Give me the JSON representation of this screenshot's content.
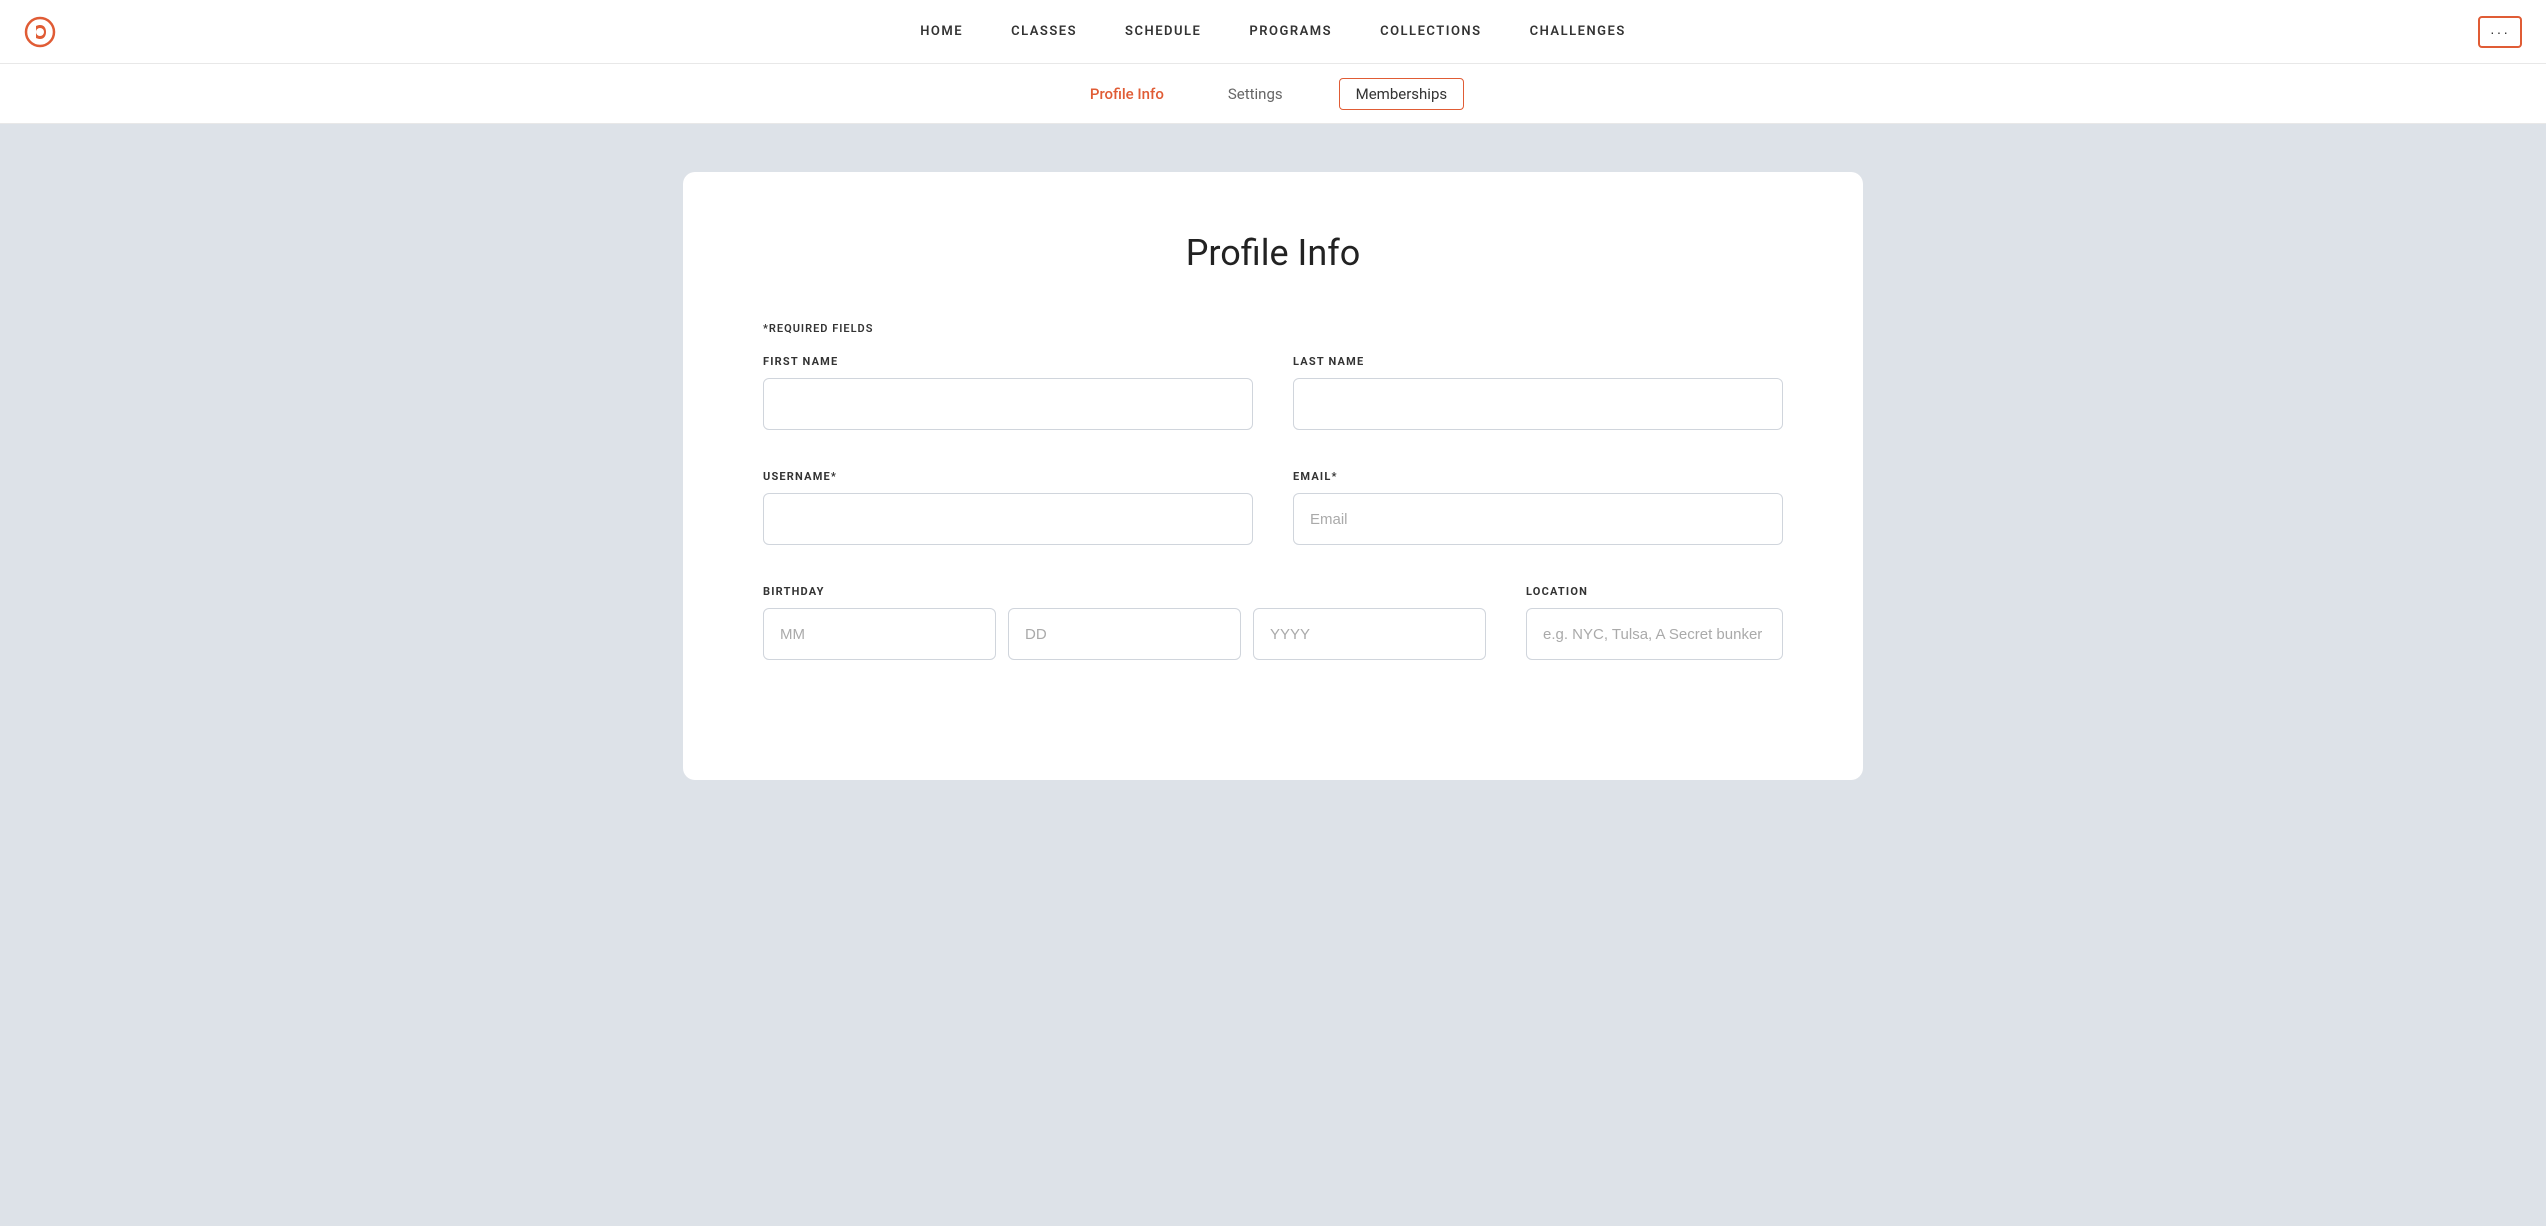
{
  "nav": {
    "logo_label": "Peloton",
    "links": [
      {
        "id": "home",
        "label": "HOME"
      },
      {
        "id": "classes",
        "label": "CLASSES"
      },
      {
        "id": "schedule",
        "label": "SCHEDULE"
      },
      {
        "id": "programs",
        "label": "PROGRAMS"
      },
      {
        "id": "collections",
        "label": "COLLECTIONS"
      },
      {
        "id": "challenges",
        "label": "CHALLENGES"
      }
    ],
    "more_button_label": "···"
  },
  "sub_nav": {
    "links": [
      {
        "id": "profile-info",
        "label": "Profile Info",
        "active": true,
        "bordered": false
      },
      {
        "id": "settings",
        "label": "Settings",
        "active": false,
        "bordered": false
      },
      {
        "id": "memberships",
        "label": "Memberships",
        "active": false,
        "bordered": true
      }
    ]
  },
  "profile": {
    "title": "Profile Info",
    "required_note": "*REQUIRED FIELDS",
    "fields": {
      "first_name_label": "FIRST NAME",
      "last_name_label": "LAST NAME",
      "username_label": "USERNAME*",
      "email_label": "EMAIL*",
      "email_placeholder": "Email",
      "birthday_label": "BIRTHDAY",
      "birthday_mm_placeholder": "MM",
      "birthday_dd_placeholder": "DD",
      "birthday_yyyy_placeholder": "YYYY",
      "location_label": "LOCATION",
      "location_placeholder": "e.g. NYC, Tulsa, A Secret bunker"
    }
  }
}
